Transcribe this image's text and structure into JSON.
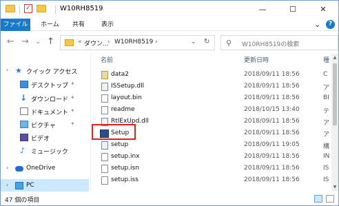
{
  "window": {
    "title": "W10RH8519",
    "controls": {
      "minimize": "—",
      "maximize": "☐",
      "close": "✕"
    }
  },
  "ribbon": {
    "file_tab": "ファイル",
    "tabs": [
      "ホーム",
      "共有",
      "表示"
    ],
    "expand": "⌄",
    "help": "?"
  },
  "nav": {
    "back": "←",
    "forward": "→",
    "dropdown": "⌄",
    "up": "↑",
    "address": {
      "prefix": "«",
      "segments": [
        "ダウン...",
        "W10RH8519"
      ],
      "separator": "›",
      "dropdown": "⌄",
      "refresh": "↻"
    },
    "search_placeholder": "W10RH8519の検索"
  },
  "sidebar": {
    "items": [
      {
        "label": "クイック アクセス",
        "icon": "star-icon",
        "pinned": false
      },
      {
        "label": "デスクトップ",
        "icon": "desktop-icon",
        "pinned": true
      },
      {
        "label": "ダウンロード",
        "icon": "download-icon",
        "pinned": true
      },
      {
        "label": "ドキュメント",
        "icon": "document-icon",
        "pinned": true
      },
      {
        "label": "ピクチャ",
        "icon": "pictures-icon",
        "pinned": true
      },
      {
        "label": "ビデオ",
        "icon": "video-icon",
        "pinned": false
      },
      {
        "label": "ミュージック",
        "icon": "music-icon",
        "pinned": false
      },
      {
        "label": "OneDrive",
        "icon": "onedrive-icon",
        "pinned": false
      },
      {
        "label": "PC",
        "icon": "pc-icon",
        "pinned": false
      }
    ],
    "pin_glyph": "✦"
  },
  "columns": {
    "name": "名前",
    "date": "更新日時",
    "type": "種"
  },
  "files": [
    {
      "name": "data2",
      "date": "2018/09/11 18:56",
      "type": "C",
      "icon": "data-file-icon"
    },
    {
      "name": "ISSetup.dll",
      "date": "2018/09/11 18:56",
      "type": "ア",
      "icon": "dll-file-icon"
    },
    {
      "name": "layout.bin",
      "date": "2018/09/11 18:56",
      "type": "BI",
      "icon": "bin-file-icon"
    },
    {
      "name": "readme",
      "date": "2018/10/15 13:40",
      "type": "テ",
      "icon": "text-file-icon"
    },
    {
      "name": "RtlExUpd.dll",
      "date": "2018/09/11 18:56",
      "type": "ア",
      "icon": "dll-file-icon"
    },
    {
      "name": "Setup",
      "date": "2018/09/11 18:56",
      "type": "ア",
      "icon": "setup-app-icon"
    },
    {
      "name": "setup",
      "date": "2018/09/11 19:05",
      "type": "構",
      "icon": "config-file-icon"
    },
    {
      "name": "setup.inx",
      "date": "2018/09/11 18:56",
      "type": "IN",
      "icon": "inx-file-icon"
    },
    {
      "name": "setup.isn",
      "date": "2018/09/11 18:56",
      "type": "IS",
      "icon": "isn-file-icon"
    },
    {
      "name": "setup.iss",
      "date": "2018/09/11 18:56",
      "type": "IS",
      "icon": "iss-file-icon"
    }
  ],
  "status": {
    "item_count": "47 個の項目"
  },
  "colors": {
    "accent": "#1979ca",
    "highlight_box": "#e0201e",
    "selection": "#cce8ff"
  }
}
